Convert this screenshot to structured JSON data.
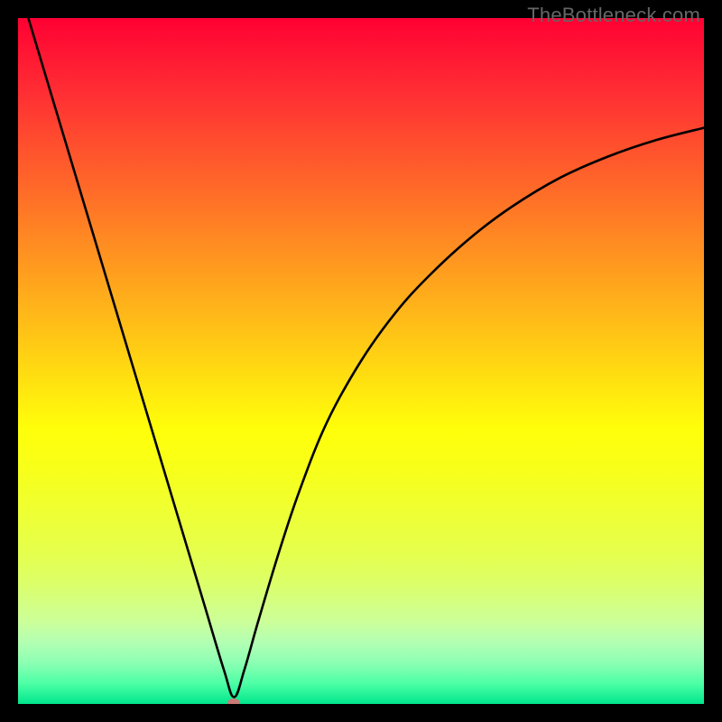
{
  "watermark": "TheBottleneck.com",
  "chart_data": {
    "type": "line",
    "title": "",
    "xlabel": "",
    "ylabel": "",
    "xlim": [
      0,
      100
    ],
    "ylim": [
      0,
      100
    ],
    "grid": false,
    "series": [
      {
        "name": "curve",
        "x": [
          0,
          3,
          6,
          9,
          12,
          15,
          18,
          21,
          24,
          27,
          30,
          31.5,
          33,
          35,
          38,
          41,
          45,
          50,
          55,
          60,
          66,
          72,
          79,
          86,
          93,
          100
        ],
        "y": [
          105,
          95,
          85,
          75,
          65,
          55,
          45,
          35,
          25,
          15,
          5,
          1,
          5,
          12,
          22,
          31,
          41,
          50,
          57,
          62.5,
          68,
          72.5,
          76.7,
          79.8,
          82.2,
          84
        ]
      }
    ],
    "minimum_marker": {
      "x": 31.5,
      "y": 0
    },
    "background": "vertical-gradient red→yellow→green",
    "frame_color": "#000000"
  }
}
